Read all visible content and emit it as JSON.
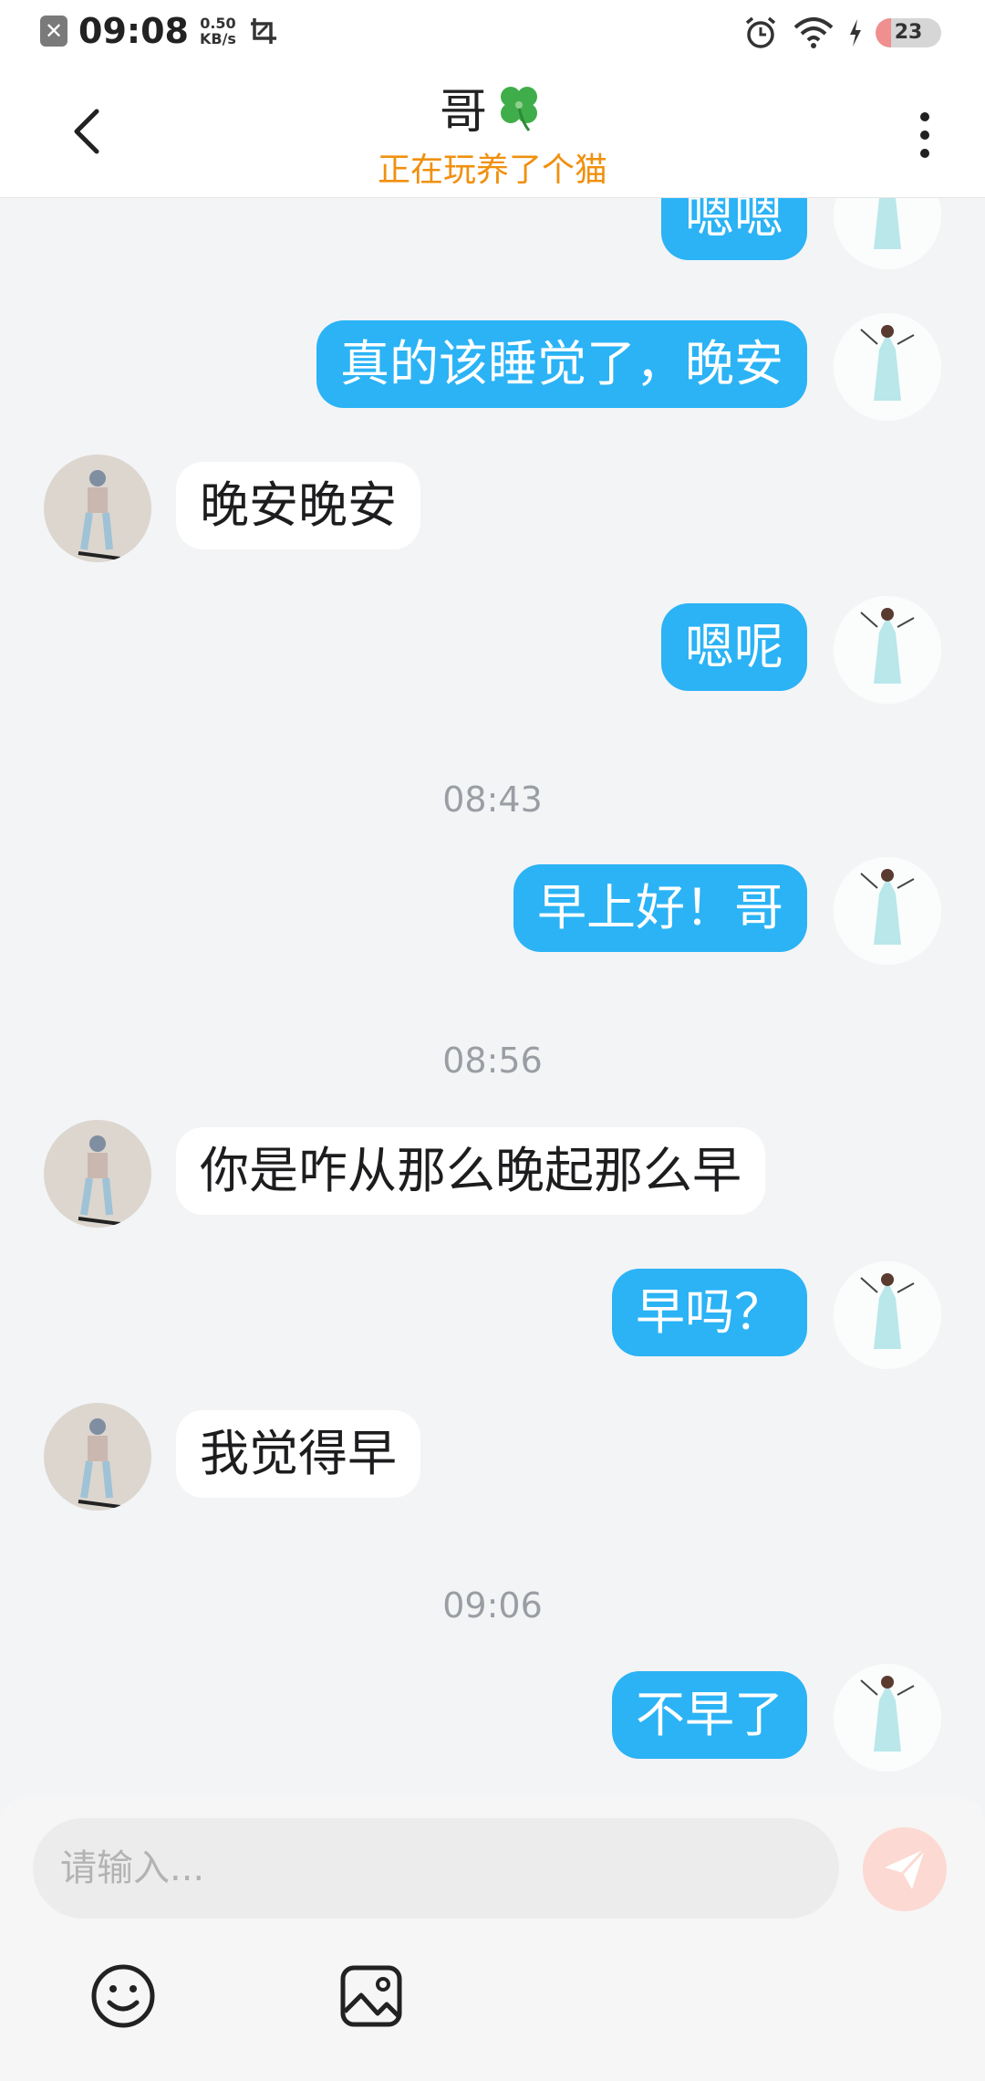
{
  "status_bar": {
    "time": "09:08",
    "speed_value": "0.50",
    "speed_unit": "KB/s",
    "battery_level": "23"
  },
  "header": {
    "title": "哥",
    "subtitle": "正在玩养了个猫"
  },
  "messages": [
    {
      "sender": "me",
      "text": "嗯嗯"
    },
    {
      "sender": "me",
      "text": "真的该睡觉了，晚安"
    },
    {
      "sender": "them",
      "text": "晚安晚安"
    },
    {
      "sender": "me",
      "text": "嗯呢"
    },
    {
      "type": "timestamp",
      "text": "08:43"
    },
    {
      "sender": "me",
      "text": "早上好！哥"
    },
    {
      "type": "timestamp",
      "text": "08:56"
    },
    {
      "sender": "them",
      "text": "你是咋从那么晚起那么早"
    },
    {
      "sender": "me",
      "text": "早吗？"
    },
    {
      "sender": "them",
      "text": "我觉得早"
    },
    {
      "type": "timestamp",
      "text": "09:06"
    },
    {
      "sender": "me",
      "text": "不早了"
    }
  ],
  "input": {
    "placeholder": "请输入..."
  },
  "colors": {
    "my_bubble": "#2bb3f5",
    "their_bubble": "#ffffff",
    "subtitle": "#f0900e",
    "send_button": "#fcd9d2"
  },
  "icons": [
    "back-arrow-icon",
    "clover-icon",
    "more-vertical-icon",
    "send-icon",
    "emoji-icon",
    "image-icon",
    "alarm-icon",
    "wifi-icon",
    "charging-icon",
    "screenshot-icon"
  ]
}
